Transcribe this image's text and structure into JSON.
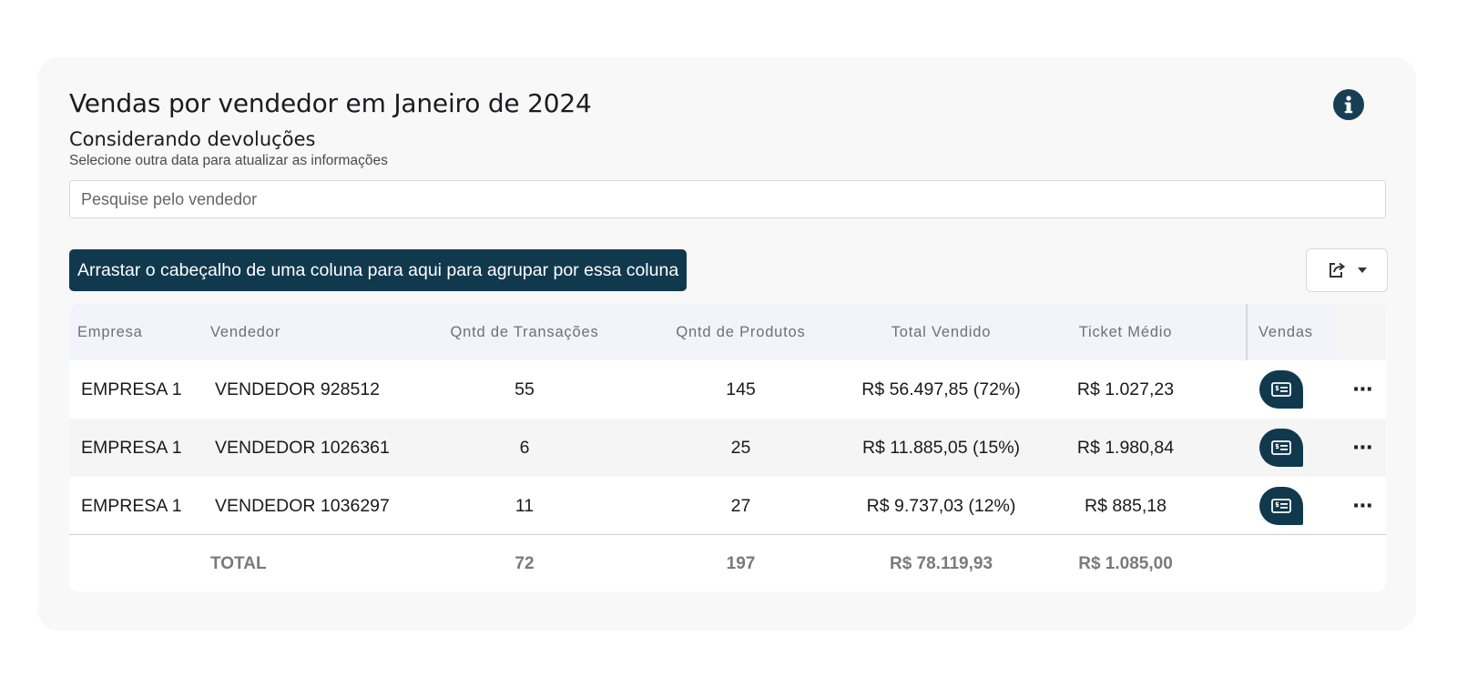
{
  "header": {
    "title": "Vendas por vendedor em Janeiro de 2024",
    "subtitle": "Considerando devoluções",
    "hint": "Selecione outra data para atualizar as informações"
  },
  "search": {
    "placeholder": "Pesquise pelo vendedor",
    "value": ""
  },
  "grouping": {
    "label": "Arrastar o cabeçalho de uma coluna para aqui para agrupar por essa coluna"
  },
  "icons": {
    "info": "info-icon",
    "export": "export-icon",
    "sales": "receipt-icon",
    "more": "more-icon"
  },
  "colors": {
    "accent": "#11394d",
    "header_bg": "#f3f3fc"
  },
  "table": {
    "columns": [
      "Empresa",
      "Vendedor",
      "Qntd de Transações",
      "Qntd de Produtos",
      "Total Vendido",
      "Ticket Médio",
      "Vendas"
    ],
    "rows": [
      {
        "empresa": "EMPRESA 1",
        "vendedor": "VENDEDOR 928512",
        "transacoes": "55",
        "produtos": "145",
        "total": "R$ 56.497,85 (72%)",
        "ticket": "R$ 1.027,23"
      },
      {
        "empresa": "EMPRESA 1",
        "vendedor": "VENDEDOR 1026361",
        "transacoes": "6",
        "produtos": "25",
        "total": "R$ 11.885,05 (15%)",
        "ticket": "R$ 1.980,84"
      },
      {
        "empresa": "EMPRESA 1",
        "vendedor": "VENDEDOR 1036297",
        "transacoes": "11",
        "produtos": "27",
        "total": "R$ 9.737,03 (12%)",
        "ticket": "R$ 885,18"
      }
    ],
    "totals": {
      "label": "TOTAL",
      "transacoes": "72",
      "produtos": "197",
      "total": "R$ 78.119,93",
      "ticket": "R$ 1.085,00"
    },
    "more_label": "⋯"
  }
}
